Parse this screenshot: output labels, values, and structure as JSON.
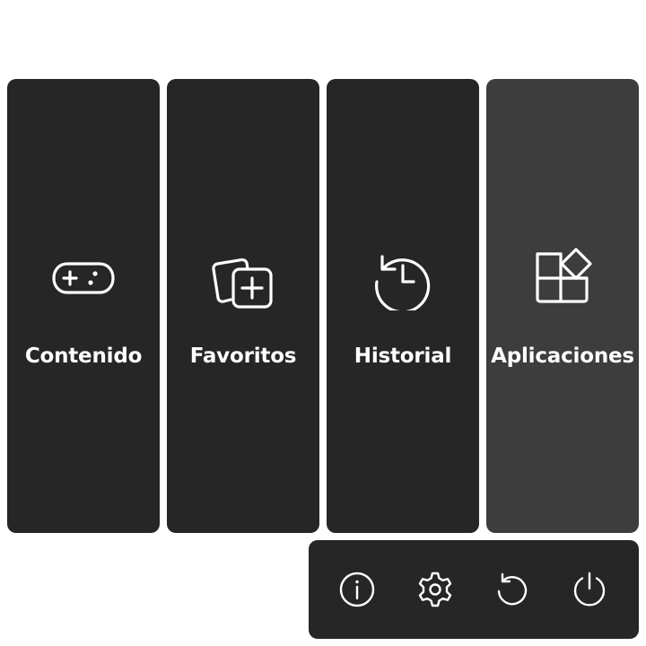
{
  "tiles": [
    {
      "id": "contenido",
      "label": "Contenido",
      "icon": "gamepad-icon",
      "selected": false
    },
    {
      "id": "favoritos",
      "label": "Favoritos",
      "icon": "add-collection-icon",
      "selected": false
    },
    {
      "id": "historial",
      "label": "Historial",
      "icon": "history-icon",
      "selected": false
    },
    {
      "id": "aplicaciones",
      "label": "Aplicaciones",
      "icon": "apps-grid-icon",
      "selected": true
    }
  ],
  "system_bar": {
    "buttons": [
      {
        "id": "info",
        "icon": "info-icon"
      },
      {
        "id": "settings",
        "icon": "gear-icon"
      },
      {
        "id": "restart",
        "icon": "restart-icon"
      },
      {
        "id": "power",
        "icon": "power-icon"
      }
    ]
  },
  "colors": {
    "tile_background": "#262626",
    "tile_selected_background": "#3d3d3d",
    "foreground": "#ffffff",
    "page_background": "#ffffff"
  }
}
